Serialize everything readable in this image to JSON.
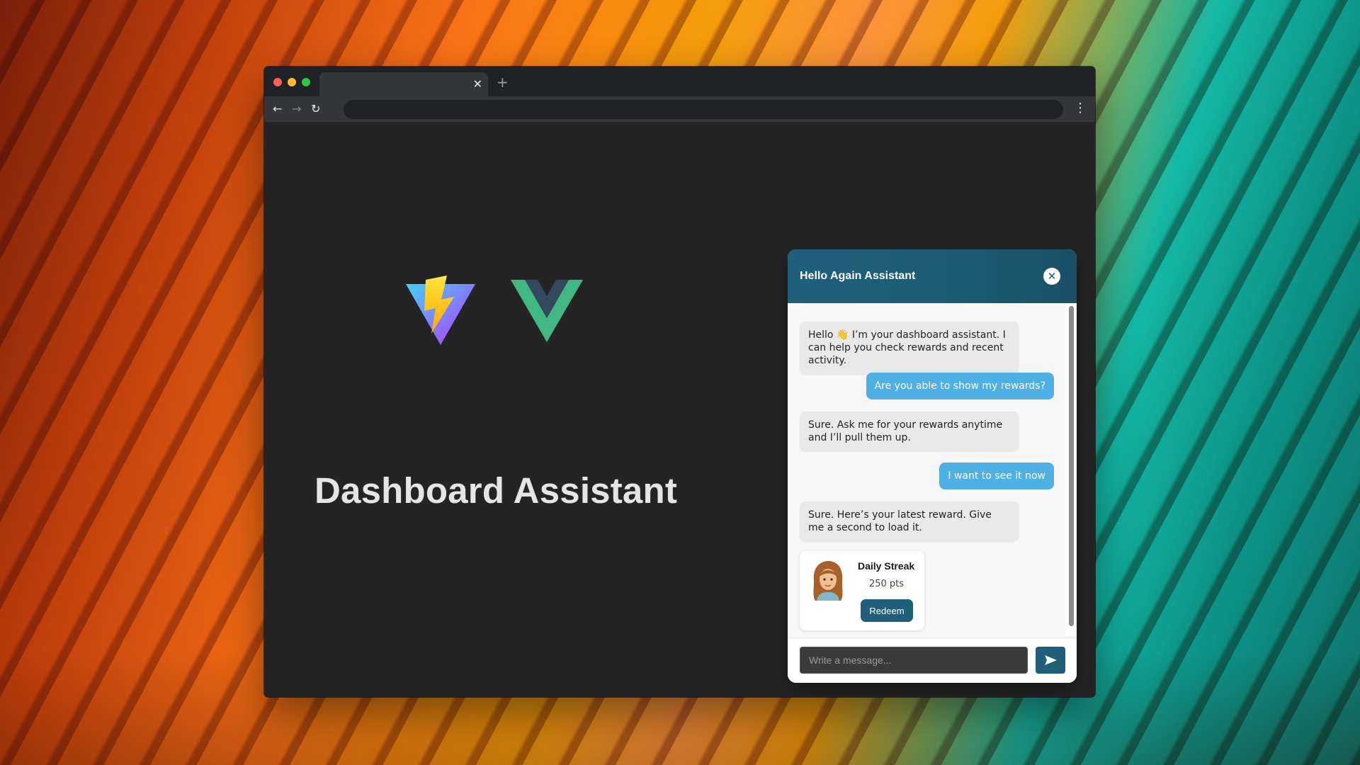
{
  "browser": {
    "tab_close_glyph": "✕",
    "new_tab_glyph": "+",
    "back_glyph": "←",
    "forward_glyph": "→",
    "reload_glyph": "↻",
    "menu_glyph": "⋮",
    "window_controls": [
      "close",
      "minimize",
      "maximize"
    ]
  },
  "page": {
    "title": "Dashboard Assistant",
    "logos": [
      "vite-logo",
      "vue-logo"
    ]
  },
  "chat": {
    "title": "Hello Again Assistant",
    "close_glyph": "✕",
    "messages": [
      {
        "role": "bot",
        "text": "Hello 👋 I’m your dashboard assistant. I can help you check rewards and recent activity."
      },
      {
        "role": "user",
        "text": "Are you able to show my rewards?"
      },
      {
        "role": "bot",
        "text": "Sure. Ask me for your rewards anytime and I’ll pull them up."
      },
      {
        "role": "user",
        "text": "I want to see it now"
      },
      {
        "role": "bot",
        "text": "Sure. Here’s your latest reward. Give me a second to load it."
      }
    ],
    "reward": {
      "name": "Daily Streak",
      "points": "250 pts",
      "button_label": "Redeem"
    },
    "input": {
      "placeholder": "Write a message..."
    }
  },
  "colors": {
    "chat_header": "#1f5f7a",
    "user_bubble": "#4fb0e6",
    "bot_bubble": "#e9e9e9",
    "window_bg": "#242424"
  },
  "icons": {
    "send": "send-icon",
    "launcher": "assistant-launcher-icon",
    "avatar": "avatar"
  }
}
